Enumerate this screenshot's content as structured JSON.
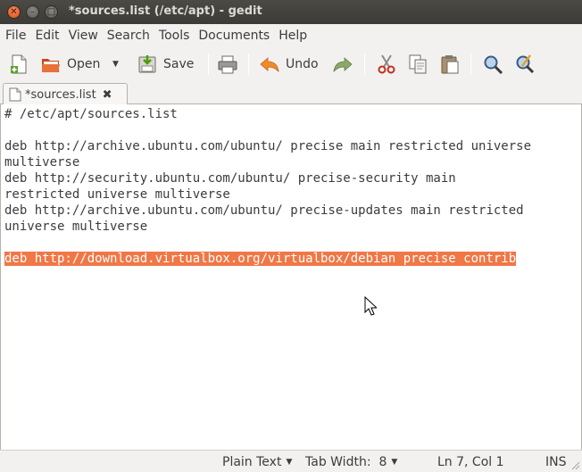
{
  "window": {
    "title": "*sources.list (/etc/apt) - gedit",
    "close_glyph": "✕",
    "minimize_glyph": "–",
    "maximize_glyph": "□"
  },
  "menubar": {
    "items": [
      "File",
      "Edit",
      "View",
      "Search",
      "Tools",
      "Documents",
      "Help"
    ]
  },
  "toolbar": {
    "new_icon": "new-document-icon",
    "open_label": "Open",
    "save_label": "Save",
    "undo_label": "Undo",
    "print_icon": "print-icon",
    "redo_icon": "redo-icon",
    "cut_icon": "cut-icon",
    "copy_icon": "copy-icon",
    "paste_icon": "paste-icon",
    "find_icon": "find-icon",
    "replace_icon": "find-replace-icon"
  },
  "tabs": [
    {
      "label": "*sources.list",
      "close_glyph": "✖"
    }
  ],
  "editor": {
    "lines": [
      "# /etc/apt/sources.list",
      "",
      "deb http://archive.ubuntu.com/ubuntu/ precise main restricted universe",
      "multiverse",
      "deb http://security.ubuntu.com/ubuntu/ precise-security main",
      "restricted universe multiverse",
      "deb http://archive.ubuntu.com/ubuntu/ precise-updates main restricted",
      "universe multiverse",
      "",
      "deb http://download.virtualbox.org/virtualbox/debian precise contrib"
    ],
    "selected_line_index": 9,
    "selection_color": "#f07746"
  },
  "statusbar": {
    "language": "Plain Text",
    "tab_width": "Tab Width:  8",
    "position": "Ln 7, Col 1",
    "mode": "INS"
  },
  "colors": {
    "titlebar": "#3c3b37",
    "close_button": "#e0501b",
    "background": "#f2f1f0"
  }
}
